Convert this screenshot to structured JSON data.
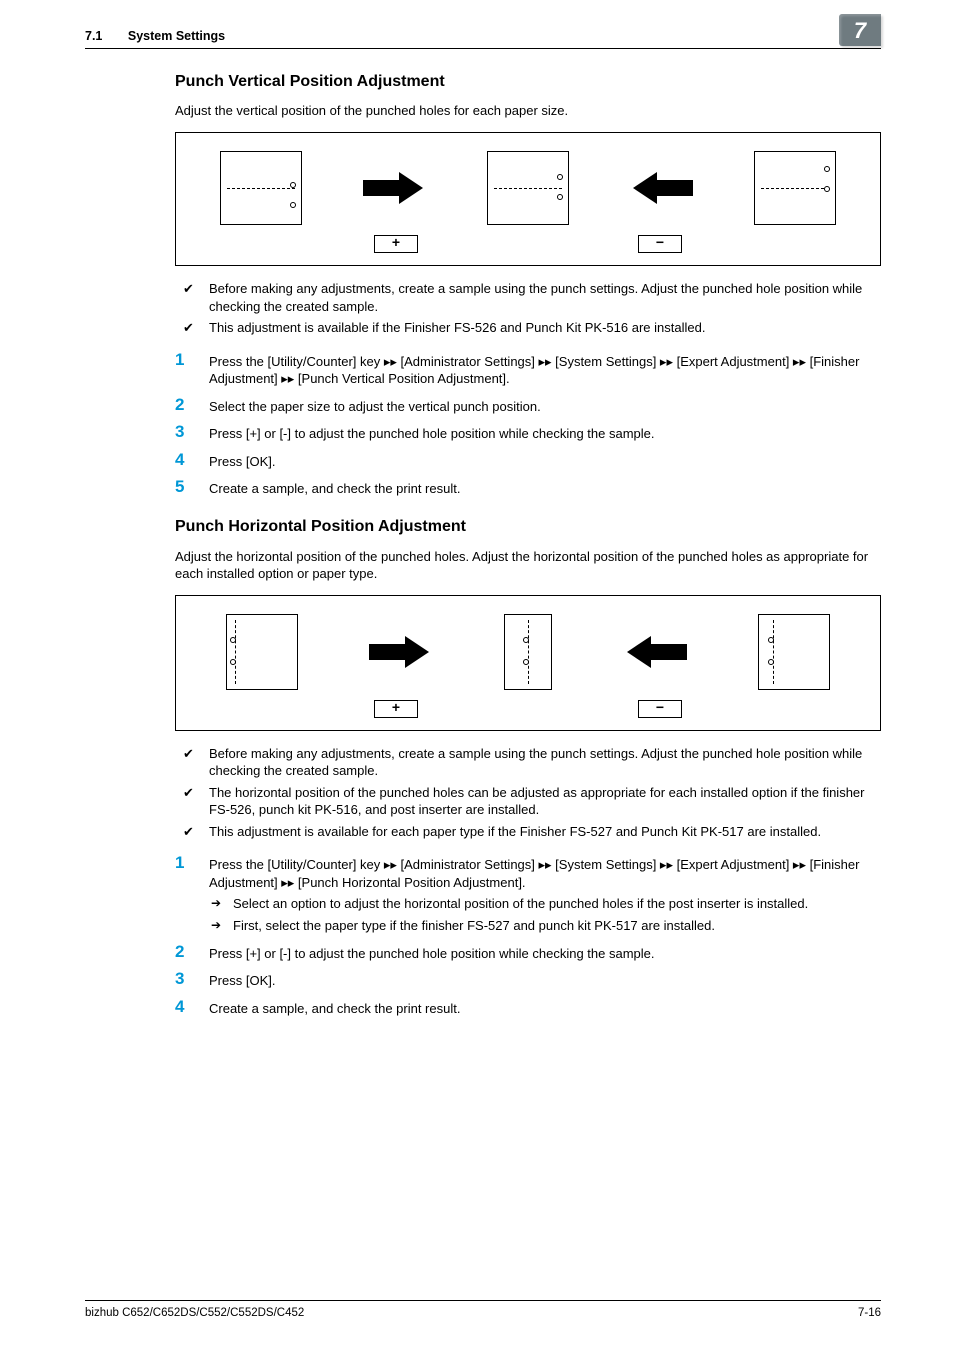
{
  "header": {
    "section_no": "7.1",
    "section_title": "System Settings",
    "chapter": "7"
  },
  "sectionA": {
    "title": "Punch Vertical Position Adjustment",
    "intro": "Adjust the vertical position of the punched holes for each paper size.",
    "checks": [
      "Before making any adjustments, create a sample using the punch settings. Adjust the punched hole position while checking the created sample.",
      "This adjustment is available if the Finisher FS-526 and Punch Kit PK-516 are installed."
    ],
    "steps": [
      "Press the [Utility/Counter] key ▸▸ [Administrator Settings] ▸▸ [System Settings] ▸▸ [Expert Adjustment] ▸▸ [Finisher Adjustment] ▸▸ [Punch Vertical Position Adjustment].",
      "Select the paper size to adjust the vertical punch position.",
      "Press [+] or [-] to adjust the punched hole position while checking the sample.",
      "Press [OK].",
      "Create a sample, and check the print result."
    ]
  },
  "sectionB": {
    "title": "Punch Horizontal Position Adjustment",
    "intro": "Adjust the horizontal position of the punched holes. Adjust the horizontal position of the punched holes as appropriate for each installed option or paper type.",
    "checks": [
      "Before making any adjustments, create a sample using the punch settings. Adjust the punched hole position while checking the created sample.",
      "The horizontal position of the punched holes can be adjusted as appropriate for each installed option if the finisher FS-526, punch kit PK-516, and post inserter are installed.",
      "This adjustment is available for each paper type if the Finisher FS-527 and Punch Kit PK-517 are installed."
    ],
    "steps": [
      {
        "main": "Press the [Utility/Counter] key ▸▸ [Administrator Settings] ▸▸ [System Settings] ▸▸ [Expert Adjustment] ▸▸ [Finisher Adjustment] ▸▸ [Punch Horizontal Position Adjustment].",
        "sub": [
          "Select an option to adjust the horizontal position of the punched holes if the post inserter is installed.",
          "First, select the paper type if the finisher FS-527 and punch kit PK-517 are installed."
        ]
      },
      {
        "main": "Press [+] or [-] to adjust the punched hole position while checking the sample."
      },
      {
        "main": "Press [OK]."
      },
      {
        "main": "Create a sample, and check the print result."
      }
    ]
  },
  "diagrams": {
    "plus": "+",
    "minus": "−"
  },
  "footer": {
    "left": "bizhub C652/C652DS/C552/C552DS/C452",
    "right": "7-16"
  }
}
